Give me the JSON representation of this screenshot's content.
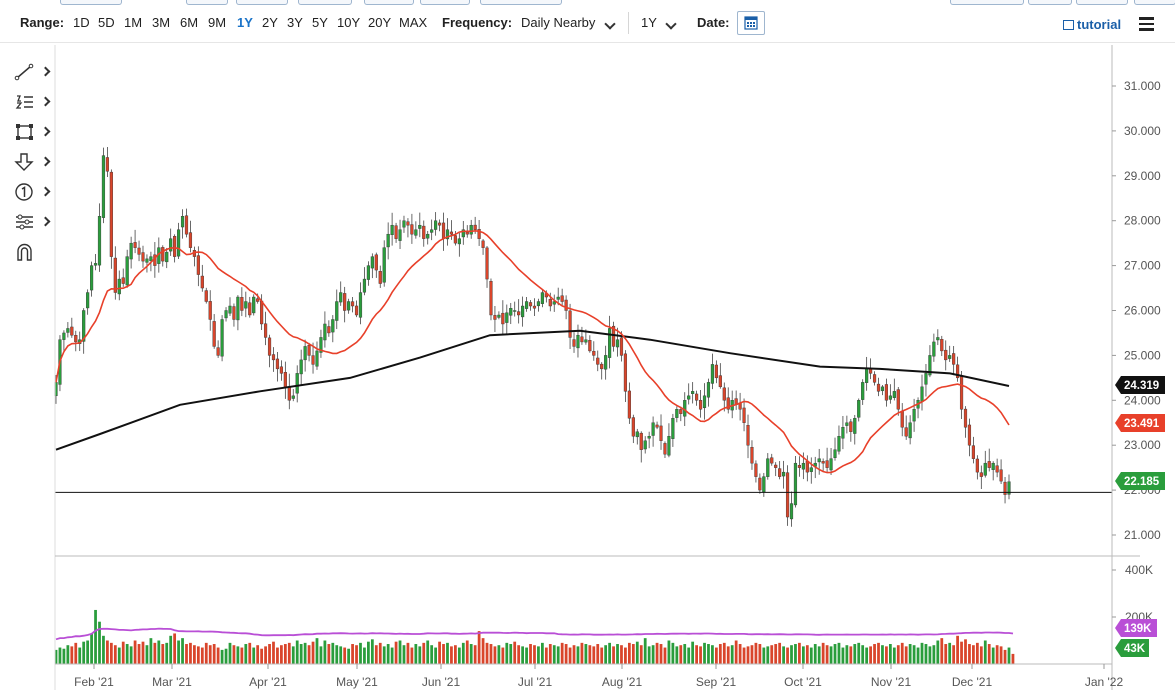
{
  "toolbar": {
    "range_label": "Range:",
    "ranges": [
      "1D",
      "5D",
      "1M",
      "3M",
      "6M",
      "9M",
      "1Y",
      "2Y",
      "3Y",
      "5Y",
      "10Y",
      "20Y",
      "MAX"
    ],
    "active_range": "1Y",
    "frequency_label": "Frequency:",
    "frequency_value": "Daily Nearby",
    "period_value": "1Y",
    "date_label": "Date:",
    "tutorial_label": "tutorial"
  },
  "left_tools": [
    "line-tool-icon",
    "text-list-icon",
    "rectangle-tool-icon",
    "arrow-down-icon",
    "number-marker-icon",
    "settings-lines-icon",
    "magnet-icon"
  ],
  "colors": {
    "up": "#2a9d3c",
    "down": "#d9452b",
    "ma_fast": "#e8402a",
    "ma_slow": "#111111",
    "volume_ma": "#b94fd6",
    "tag_slow": "#111111",
    "tag_fast": "#e8402a",
    "tag_price": "#2a9d3c",
    "tag_volume_avg": "#b94fd6",
    "tag_volume": "#2a9d3c"
  },
  "chart_data": {
    "type": "candlestick",
    "price_axis": {
      "min": 21.0,
      "max": 31.0,
      "ticks": [
        "21.000",
        "22.000",
        "23.000",
        "24.000",
        "25.000",
        "26.000",
        "27.000",
        "28.000",
        "29.000",
        "30.000",
        "31.000"
      ]
    },
    "volume_axis": {
      "ticks": [
        "200K",
        "400K"
      ]
    },
    "x_labels": [
      "Feb '21",
      "Mar '21",
      "Apr '21",
      "May '21",
      "Jun '21",
      "Jul '21",
      "Aug '21",
      "Sep '21",
      "Oct '21",
      "Nov '21",
      "Dec '21",
      "Jan '22"
    ],
    "horizontal_line": 21.95,
    "tags": {
      "ma_slow": "24.319",
      "ma_fast": "23.491",
      "price": "22.185",
      "volume_avg": "139K",
      "volume": "43K"
    },
    "closes": [
      24.4,
      25.35,
      25.5,
      25.6,
      25.45,
      25.3,
      25.35,
      26.0,
      26.4,
      27.0,
      27.05,
      28.1,
      29.45,
      29.1,
      27.2,
      26.4,
      26.7,
      26.6,
      27.2,
      27.5,
      27.4,
      27.25,
      27.1,
      27.15,
      27.2,
      27.0,
      27.4,
      27.1,
      27.3,
      27.6,
      27.2,
      27.8,
      28.1,
      27.7,
      27.4,
      27.2,
      26.8,
      26.5,
      26.2,
      25.8,
      25.2,
      25.0,
      25.8,
      26.0,
      26.1,
      25.8,
      26.3,
      26.0,
      26.2,
      25.9,
      26.3,
      26.2,
      25.7,
      25.4,
      25.0,
      24.9,
      24.7,
      24.6,
      24.3,
      24.0,
      24.1,
      24.6,
      24.9,
      25.2,
      25.0,
      24.8,
      25.1,
      25.4,
      25.7,
      25.5,
      25.8,
      26.2,
      26.4,
      26.0,
      26.2,
      26.1,
      25.9,
      26.4,
      26.7,
      27.0,
      27.2,
      26.9,
      26.6,
      27.4,
      27.7,
      27.9,
      27.6,
      27.8,
      28.0,
      27.9,
      27.7,
      27.8,
      27.9,
      27.6,
      27.7,
      27.8,
      28.0,
      27.9,
      27.6,
      27.8,
      27.7,
      27.5,
      27.6,
      27.8,
      27.7,
      27.9,
      27.8,
      27.6,
      27.4,
      26.7,
      25.9,
      25.8,
      25.9,
      25.7,
      25.95,
      26.05,
      26.0,
      25.9,
      26.1,
      26.2,
      26.1,
      26.05,
      26.2,
      26.4,
      26.3,
      26.1,
      26.2,
      26.3,
      26.2,
      26.0,
      25.4,
      25.2,
      25.45,
      25.3,
      25.35,
      25.1,
      25.0,
      24.8,
      24.7,
      25.0,
      25.6,
      25.2,
      25.35,
      25.0,
      24.2,
      23.6,
      23.2,
      23.3,
      22.9,
      23.1,
      23.2,
      23.5,
      23.4,
      23.1,
      22.8,
      23.2,
      23.6,
      23.8,
      23.7,
      24.0,
      24.1,
      24.2,
      24.0,
      23.8,
      24.1,
      24.4,
      24.8,
      24.5,
      24.3,
      24.0,
      23.8,
      24.0,
      23.9,
      23.8,
      23.5,
      23.0,
      22.6,
      22.3,
      22.0,
      22.3,
      22.7,
      22.6,
      22.5,
      22.3,
      22.4,
      21.4,
      21.7,
      22.6,
      22.5,
      22.6,
      22.4,
      22.5,
      22.6,
      22.7,
      22.6,
      22.5,
      22.7,
      22.9,
      23.2,
      23.4,
      23.5,
      23.3,
      23.6,
      24.0,
      24.4,
      24.7,
      24.6,
      24.4,
      24.2,
      24.3,
      24.0,
      24.1,
      24.2,
      23.8,
      23.4,
      23.2,
      23.5,
      23.8,
      24.0,
      24.3,
      24.6,
      25.0,
      25.3,
      25.4,
      25.1,
      24.9,
      25.0,
      24.8,
      24.5,
      23.8,
      23.4,
      23.0,
      22.7,
      22.4,
      22.3,
      22.6,
      22.5,
      22.6,
      22.4,
      22.2,
      21.9,
      22.185
    ],
    "volume_K": [
      60,
      70,
      65,
      80,
      75,
      90,
      70,
      95,
      100,
      130,
      230,
      180,
      120,
      100,
      90,
      80,
      70,
      95,
      85,
      75,
      100,
      85,
      95,
      80,
      110,
      90,
      100,
      85,
      90,
      120,
      130,
      100,
      110,
      85,
      90,
      80,
      75,
      70,
      90,
      80,
      85,
      70,
      60,
      65,
      90,
      80,
      75,
      70,
      85,
      90,
      70,
      80,
      65,
      75,
      85,
      95,
      70,
      80,
      85,
      90,
      75,
      100,
      85,
      90,
      80,
      95,
      110,
      75,
      100,
      85,
      90,
      80,
      75,
      70,
      65,
      85,
      80,
      90,
      70,
      95,
      105,
      80,
      90,
      75,
      85,
      70,
      95,
      100,
      80,
      90,
      70,
      85,
      75,
      90,
      100,
      80,
      70,
      95,
      85,
      90,
      75,
      80,
      70,
      90,
      100,
      85,
      80,
      140,
      110,
      90,
      85,
      75,
      80,
      70,
      90,
      85,
      95,
      80,
      75,
      70,
      85,
      80,
      75,
      90,
      70,
      85,
      80,
      75,
      90,
      85,
      70,
      80,
      75,
      90,
      85,
      80,
      75,
      85,
      70,
      80,
      90,
      75,
      85,
      80,
      70,
      90,
      85,
      95,
      80,
      110,
      75,
      80,
      90,
      85,
      70,
      100,
      90,
      75,
      80,
      85,
      70,
      95,
      80,
      75,
      90,
      85,
      80,
      70,
      85,
      90,
      75,
      80,
      100,
      85,
      70,
      75,
      80,
      90,
      85,
      70,
      75,
      80,
      85,
      90,
      75,
      70,
      80,
      85,
      90,
      75,
      80,
      70,
      85,
      75,
      90,
      80,
      75,
      85,
      90,
      70,
      80,
      75,
      85,
      90,
      80,
      70,
      75,
      85,
      90,
      80,
      75,
      85,
      70,
      80,
      90,
      75,
      85,
      80,
      70,
      90,
      85,
      75,
      80,
      100,
      110,
      85,
      90,
      80,
      120,
      95,
      105,
      85,
      80,
      90,
      75,
      100,
      85,
      70,
      80,
      75,
      60,
      70,
      43
    ]
  }
}
